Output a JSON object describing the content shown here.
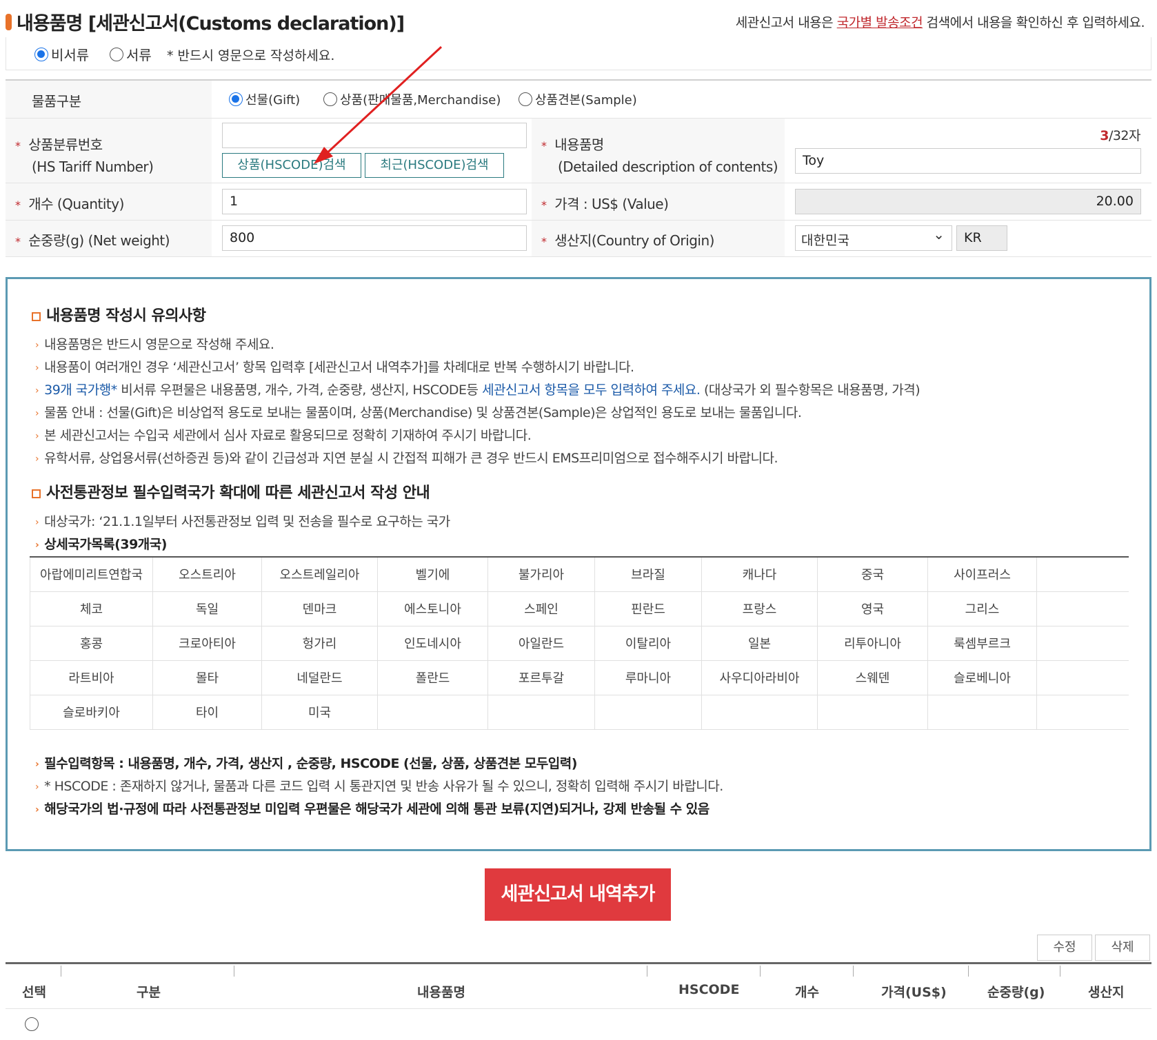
{
  "header": {
    "title": "내용품명 [세관신고서(Customs declaration)]",
    "note_prefix": "세관신고서 내용은 ",
    "note_link": "국가별 발송조건",
    "note_suffix": " 검색에서 내용을 확인하신 후 입력하세요."
  },
  "doc_type": {
    "options": [
      "비서류",
      "서류"
    ],
    "selected": "비서류",
    "notice": "* 반드시 영문으로 작성하세요."
  },
  "form": {
    "item_type_label": "물품구분",
    "item_type_options": [
      "선물(Gift)",
      "상품(판매물품,Merchandise)",
      "상품견본(Sample)"
    ],
    "item_type_selected": "선물(Gift)",
    "hs_label": "상품분류번호",
    "hs_label_en": "(HS Tariff Number)",
    "hs_value": "",
    "hs_search_button": "상품(HSCODE)검색",
    "hs_recent_button": "최근(HSCODE)검색",
    "contents_label": "내용품명",
    "contents_label_en": "(Detailed description of contents)",
    "contents_count": "3",
    "contents_max": "/32자",
    "contents_value": "Toy",
    "quantity_label": "개수 (Quantity)",
    "quantity_value": "1",
    "value_label": "가격 : US$ (Value)",
    "value_value": "20.00",
    "weight_label": "순중량(g) (Net weight)",
    "weight_value": "800",
    "origin_label": "생산지(Country of Origin)",
    "origin_value": "대한민국",
    "origin_code": "KR"
  },
  "info": {
    "section1_title": "내용품명 작성시 유의사항",
    "lines1": [
      "내용품명은 반드시 영문으로 작성해 주세요.",
      "내용품이 여러개인 경우 ‘세관신고서’ 항목 입력후 [세관신고서 내역추가]를 차례대로 반복 수행하시기 바랍니다.",
      "물품 안내 : 선물(Gift)은 비상업적 용도로 보내는 물품이며, 상품(Merchandise) 및 상품견본(Sample)은 상업적인 용도로 보내는 물품입니다.",
      "본 세관신고서는 수입국 세관에서 심사 자료로 활용되므로 정확히 기재하여 주시기 바랍니다.",
      "유학서류, 상업용서류(선하증권 등)와 같이 긴급성과 지연 분실 시 간접적 피해가 큰 경우 반드시 EMS프리미엄으로 접수해주시기 바랍니다."
    ],
    "line_39_blue1": "39개 국가행*",
    "line_39_mid": " 비서류 우편물은 내용품명, 개수, 가격, 순중량, 생산지, HSCODE등 ",
    "line_39_blue2": "세관신고서 항목을 모두 입력하여 주세요.",
    "line_39_tail": " (대상국가 외 필수항목은 내용품명, 가격)",
    "section2_title": "사전통관정보 필수입력국가 확대에 따른 세관신고서 작성 안내",
    "target_line": "대상국가: ‘21.1.1일부터 사전통관정보 입력 및 전송을 필수로 요구하는 국가",
    "list_title": "상세국가목록(39개국)",
    "countries": [
      [
        "아랍에미리트연합국",
        "오스트리아",
        "오스트레일리아",
        "벨기에",
        "불가리아",
        "브라질",
        "캐나다",
        "중국",
        "사이프러스"
      ],
      [
        "체코",
        "독일",
        "덴마크",
        "에스토니아",
        "스페인",
        "핀란드",
        "프랑스",
        "영국",
        "그리스"
      ],
      [
        "홍콩",
        "크로아티아",
        "헝가리",
        "인도네시아",
        "아일란드",
        "이탈리아",
        "일본",
        "리투아니아",
        "룩셈부르크"
      ],
      [
        "라트비아",
        "몰타",
        "네덜란드",
        "폴란드",
        "포르투갈",
        "루마니아",
        "사우디아라비아",
        "스웨덴",
        "슬로베니아"
      ],
      [
        "슬로바키아",
        "타이",
        "미국",
        "",
        "",
        "",
        "",
        "",
        ""
      ]
    ],
    "required_line": "필수입력항목 : 내용품명, 개수, 가격, 생산지 , 순중량, HSCODE (선물, 상품, 상품견본 모두입력)",
    "hscode_warning": "* HSCODE : 존재하지 않거나, 물품과 다른 코드 입력 시 통관지연 및 반송 사유가 될 수 있으니, 정확히 입력해 주시기 바랍니다.",
    "law_line": "해당국가의 법·규정에 따라 사전통관정보 미입력 우편물은 해당국가 세관에 의해 통관 보류(지연)되거나, 강제 반송될 수 있음"
  },
  "add_button": "세관신고서 내역추가",
  "list_buttons": {
    "edit": "수정",
    "delete": "삭제"
  },
  "list_headers": [
    "선택",
    "구분",
    "내용품명",
    "HSCODE",
    "개수",
    "가격(US$)",
    "순중량(g)",
    "생산지"
  ],
  "colors": {
    "accent": "#e8722a",
    "red": "#c0282d",
    "button": "#e03a3e",
    "border": "#5b9ab3",
    "radio": "#1a73e8"
  }
}
